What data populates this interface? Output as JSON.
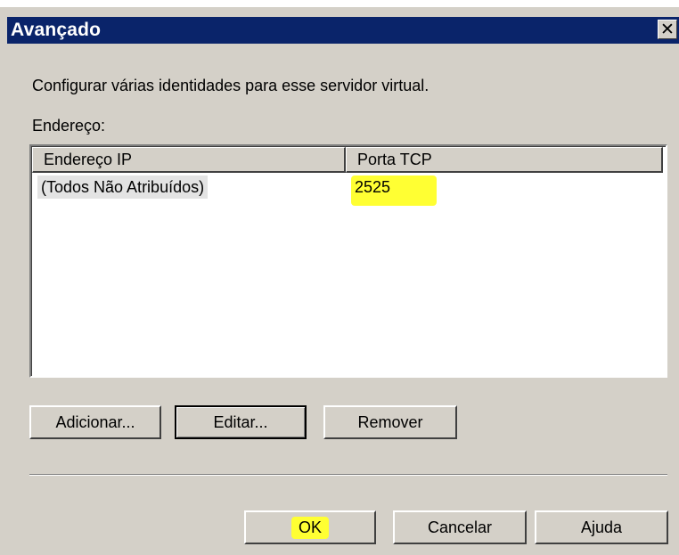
{
  "window": {
    "title": "Avançado",
    "close_glyph": "✕"
  },
  "description": "Configurar várias identidades para esse servidor virtual.",
  "address_label": "Endereço:",
  "list": {
    "columns": [
      "Endereço IP",
      "Porta TCP"
    ],
    "rows": [
      {
        "ip": "(Todos Não Atribuídos)",
        "port": "2525"
      }
    ],
    "highlight_color": "#ffff33"
  },
  "buttons": {
    "add": "Adicionar...",
    "edit": "Editar...",
    "remove": "Remover",
    "ok": "OK",
    "cancel": "Cancelar",
    "help": "Ajuda"
  },
  "colors": {
    "titlebar": "#0a246a",
    "dialog_bg": "#d4d0c8"
  }
}
